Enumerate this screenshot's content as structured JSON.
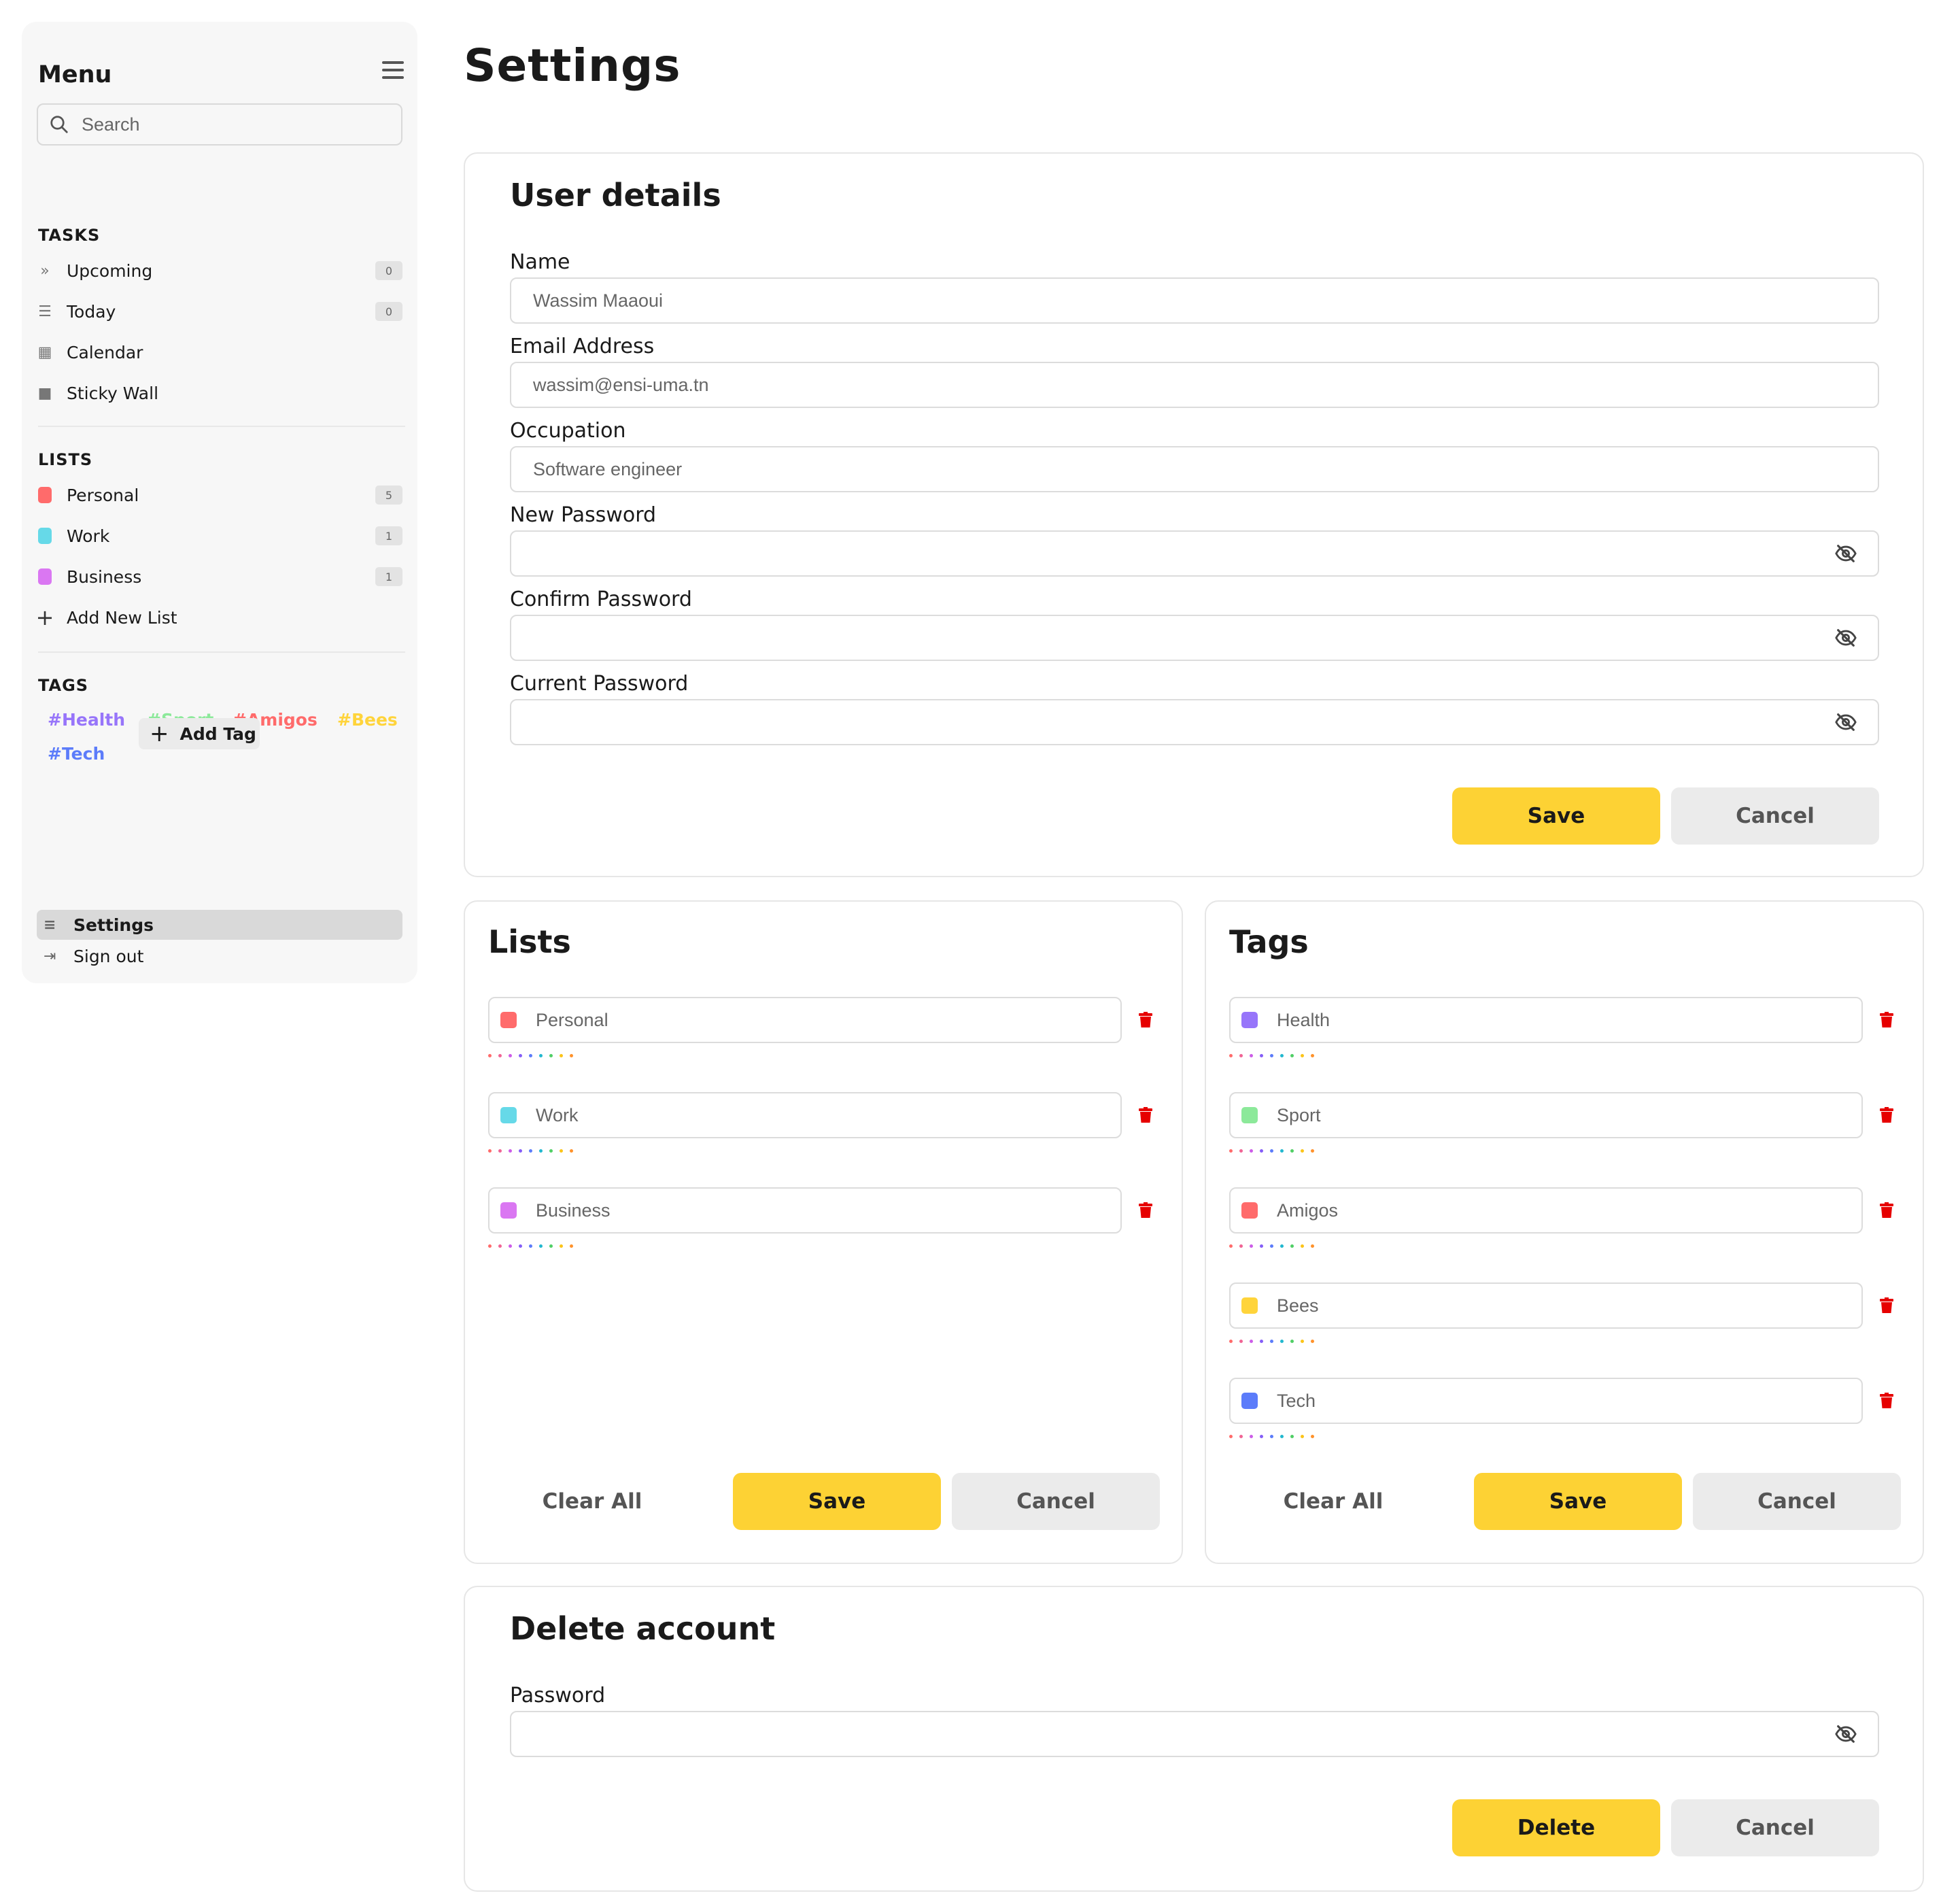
{
  "sidebar": {
    "title": "Menu",
    "search_placeholder": "Search",
    "tasks_heading": "TASKS",
    "tasks": [
      {
        "label": "Upcoming",
        "count": "0",
        "icon": "double-chevron-icon"
      },
      {
        "label": "Today",
        "count": "0",
        "icon": "checklist-icon"
      },
      {
        "label": "Calendar",
        "icon": "calendar-icon"
      },
      {
        "label": "Sticky Wall",
        "icon": "sticky-note-icon"
      }
    ],
    "lists_heading": "LISTS",
    "lists": [
      {
        "label": "Personal",
        "count": "5",
        "color": "#ff6b6b"
      },
      {
        "label": "Work",
        "count": "1",
        "color": "#66d9e8"
      },
      {
        "label": "Business",
        "count": "1",
        "color": "#da77f2"
      }
    ],
    "add_list_label": "Add New List",
    "tags_heading": "TAGS",
    "tags": [
      {
        "label": "#Health",
        "color": "#9775fa"
      },
      {
        "label": "#Sport",
        "color": "#8ce99a"
      },
      {
        "label": "#Amigos",
        "color": "#ff6b6b"
      },
      {
        "label": "#Bees",
        "color": "#ffd43b"
      },
      {
        "label": "#Tech",
        "color": "#5c7cfa"
      }
    ],
    "add_tag_label": "Add Tag",
    "settings_label": "Settings",
    "signout_label": "Sign out"
  },
  "page": {
    "title": "Settings"
  },
  "user_details": {
    "title": "User details",
    "name_label": "Name",
    "name_value": "Wassim Maaoui",
    "email_label": "Email Address",
    "email_value": "wassim@ensi-uma.tn",
    "occupation_label": "Occupation",
    "occupation_value": "Software engineer",
    "new_password_label": "New Password",
    "confirm_password_label": "Confirm Password",
    "current_password_label": "Current Password",
    "save_label": "Save",
    "cancel_label": "Cancel"
  },
  "lists_card": {
    "title": "Lists",
    "items": [
      {
        "label": "Personal",
        "color": "#ff6b6b"
      },
      {
        "label": "Work",
        "color": "#66d9e8"
      },
      {
        "label": "Business",
        "color": "#da77f2"
      }
    ],
    "clear_label": "Clear All",
    "save_label": "Save",
    "cancel_label": "Cancel"
  },
  "tags_card": {
    "title": "Tags",
    "items": [
      {
        "label": "Health",
        "color": "#9775fa"
      },
      {
        "label": "Sport",
        "color": "#8ce99a"
      },
      {
        "label": "Amigos",
        "color": "#ff6b6b"
      },
      {
        "label": "Bees",
        "color": "#ffd43b"
      },
      {
        "label": "Tech",
        "color": "#5c7cfa"
      }
    ],
    "clear_label": "Clear All",
    "save_label": "Save",
    "cancel_label": "Cancel"
  },
  "delete_account": {
    "title": "Delete account",
    "password_label": "Password",
    "delete_label": "Delete",
    "cancel_label": "Cancel"
  },
  "palette": [
    "#ff6b6b",
    "#f06595",
    "#cc5de8",
    "#845ef7",
    "#5c7cfa",
    "#22b8cf",
    "#51cf66",
    "#fcc419",
    "#ff922b"
  ],
  "colors": {
    "accent": "#fdd234",
    "danger": "#e60000"
  }
}
